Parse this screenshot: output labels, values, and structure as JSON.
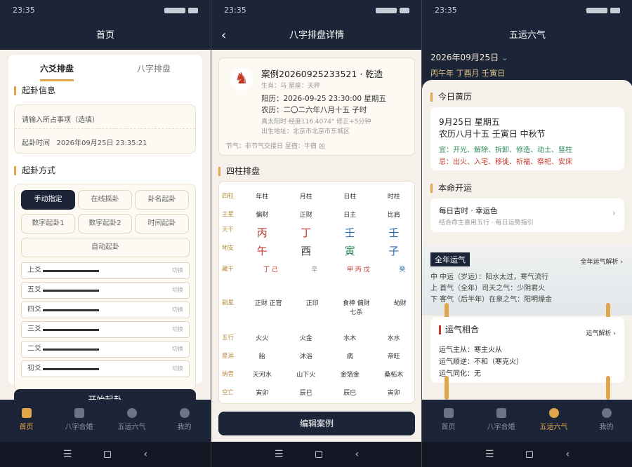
{
  "status": {
    "time": "23:35",
    "battery": "48"
  },
  "tabs": [
    {
      "label": "首页",
      "icon": "grid-icon"
    },
    {
      "label": "八字合婚",
      "icon": "document-icon"
    },
    {
      "label": "五运六气",
      "icon": "dharma-wheel-icon"
    },
    {
      "label": "我的",
      "icon": "person-icon"
    }
  ],
  "p1": {
    "title": "首页",
    "subtabs": [
      "六爻排盘",
      "八字排盘"
    ],
    "section1": "起卦信息",
    "input_placeholder": "请输入所占事项（选填）",
    "time_label": "起卦时间",
    "time_value": "2026年09月25日 23:35:21",
    "section2": "起卦方式",
    "methods": [
      "手动指定",
      "在线摇卦",
      "卦名起卦",
      "数字起卦1",
      "数字起卦2",
      "时间起卦",
      "自动起卦"
    ],
    "yao": [
      "上爻",
      "五爻",
      "四爻",
      "三爻",
      "二爻",
      "初爻"
    ],
    "switch": "切换",
    "start_button": "开始起卦"
  },
  "p2": {
    "title": "八字排盘详情",
    "case_title": "案例20260925233521",
    "case_gender": "乾造",
    "zodiac": "生肖：马  星座：天秤",
    "solar": "阳历：2026-09-25 23:30:00  星期五",
    "lunar": "农历：二〇二六年八月十五 子时",
    "true_solar": "真太阳时  经度116.4074°  修正+5分钟",
    "birthplace": "出生地址：北京市北京市东城区",
    "jieqi": "节气：非节气交接日  星宿：牛宿  凶",
    "pillars_title": "四柱排盘",
    "rows": [
      {
        "h": "四柱",
        "c": [
          "年柱",
          "月柱",
          "日柱",
          "时柱"
        ]
      },
      {
        "h": "主星",
        "c": [
          "偏财",
          "正财",
          "日主",
          "比肩"
        ]
      },
      {
        "h": "天干",
        "c": [
          "丙",
          "丁",
          "壬",
          "壬"
        ]
      },
      {
        "h": "地支",
        "c": [
          "午",
          "酉",
          "寅",
          "子"
        ]
      },
      {
        "h": "藏干",
        "c": [
          "丁 己",
          "辛",
          "甲 丙 戊",
          "癸"
        ]
      },
      {
        "h": "副星",
        "c": [
          "正财 正官",
          "正印",
          "食神 偏财 七杀",
          "劫财"
        ]
      },
      {
        "h": "五行",
        "c": [
          "火火",
          "火金",
          "水木",
          "水水"
        ]
      },
      {
        "h": "星运",
        "c": [
          "胎",
          "沐浴",
          "病",
          "帝旺"
        ]
      },
      {
        "h": "纳音",
        "c": [
          "天河水",
          "山下火",
          "金箔金",
          "桑柘木"
        ]
      },
      {
        "h": "空亡",
        "c": [
          "寅卯",
          "辰巳",
          "辰巳",
          "寅卯"
        ]
      }
    ],
    "edit_button": "编辑案例"
  },
  "p3": {
    "title": "五运六气",
    "date": "2026年09月25日",
    "ganzhi": "丙午年 丁酉月 壬寅日",
    "almanac_title": "今日黄历",
    "day_line": "9月25日 星期五",
    "lunar_line": "农历八月十五  壬寅日  中秋节",
    "yi": "宜：开光、解除、拆卸、修造、动土、竖柱",
    "ji": "忌：出火、入宅、移徙、祈福、祭祀、安床",
    "luck_title": "本命开运",
    "luck_main": "每日吉时 · 幸运色",
    "luck_sub": "结合命主喜用五行 · 每日运势指引",
    "year_title": "全年运气",
    "year_link": "全年运气解析",
    "year_lines": [
      "中 中运（岁运）：阳水太过，寒气流行",
      "上 首气（全年）司天之气：少阴君火",
      "下 客气（后半年）在泉之气：阳明燥金"
    ],
    "match_title": "运气相合",
    "match_link": "运气解析",
    "match_lines": [
      "运气主从：寒主火从",
      "运气顺逆：不和（寒克火）",
      "运气同化：无"
    ]
  }
}
